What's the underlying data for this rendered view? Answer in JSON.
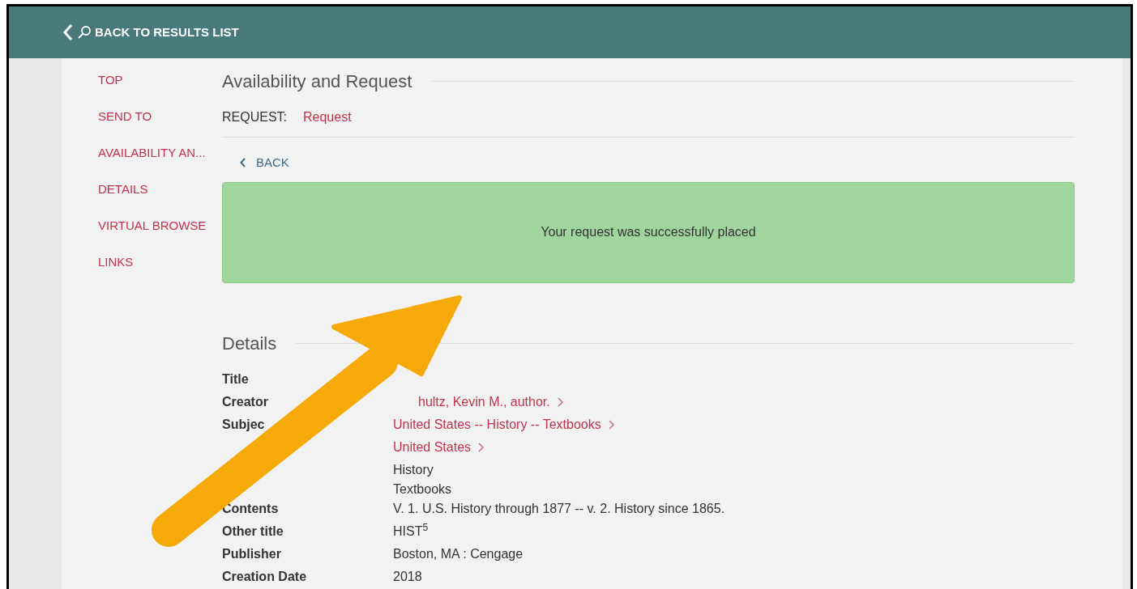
{
  "header": {
    "back_label": "BACK TO RESULTS LIST"
  },
  "sidebar": {
    "items": [
      {
        "label": "TOP"
      },
      {
        "label": "SEND TO"
      },
      {
        "label": "AVAILABILITY AN..."
      },
      {
        "label": "DETAILS"
      },
      {
        "label": "VIRTUAL BROWSE"
      },
      {
        "label": "LINKS"
      }
    ]
  },
  "availability": {
    "heading": "Availability and Request",
    "request_label": "REQUEST:",
    "request_link": "Request",
    "back": "BACK",
    "message": "Your request was successfully placed"
  },
  "details": {
    "heading": "Details",
    "rows": [
      {
        "label": "Title",
        "values": []
      },
      {
        "label": "Creator",
        "values": [
          {
            "text": "hultz, Kevin M., author.",
            "kind": "covered-link"
          }
        ]
      },
      {
        "label": "Subjec",
        "values": [
          {
            "text": "United States -- History -- Textbooks",
            "kind": "link"
          },
          {
            "text": "United States",
            "kind": "link"
          },
          {
            "text": "History",
            "kind": "text"
          },
          {
            "text": "Textbooks",
            "kind": "text"
          }
        ]
      },
      {
        "label": "Contents",
        "values": [
          {
            "text": "V. 1. U.S. History through 1877 -- v. 2. History since 1865.",
            "kind": "text"
          }
        ]
      },
      {
        "label": "Other title",
        "values": [
          {
            "text": "HIST$^{5}$",
            "kind": "text"
          }
        ]
      },
      {
        "label": "Publisher",
        "values": [
          {
            "text": "Boston, MA : Cengage",
            "kind": "text"
          }
        ]
      },
      {
        "label": "Creation Date",
        "values": [
          {
            "text": "2018",
            "kind": "text"
          }
        ]
      }
    ]
  }
}
